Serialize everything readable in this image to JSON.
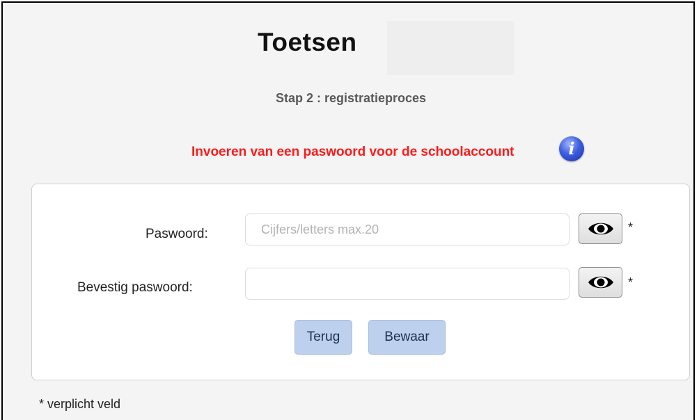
{
  "header": {
    "title": "Toetsen",
    "step": "Stap 2 : registratieproces",
    "instruction": "Invoeren van een paswoord voor de schoolaccount",
    "info_icon": "info-icon",
    "info_glyph": "i"
  },
  "form": {
    "password": {
      "label": "Paswoord:",
      "value": "",
      "placeholder": "Cijfers/letters max.20",
      "toggle_icon": "eye-icon",
      "required_mark": "*"
    },
    "confirm": {
      "label": "Bevestig paswoord:",
      "value": "",
      "placeholder": "",
      "toggle_icon": "eye-icon",
      "required_mark": "*"
    },
    "buttons": {
      "back": "Terug",
      "save": "Bewaar"
    }
  },
  "footnote": "* verplicht veld",
  "colors": {
    "instruction": "#ff1a1a",
    "button_bg": "#bdd0ee",
    "page_bg": "#f4f4f4",
    "panel_bg": "#ffffff"
  }
}
